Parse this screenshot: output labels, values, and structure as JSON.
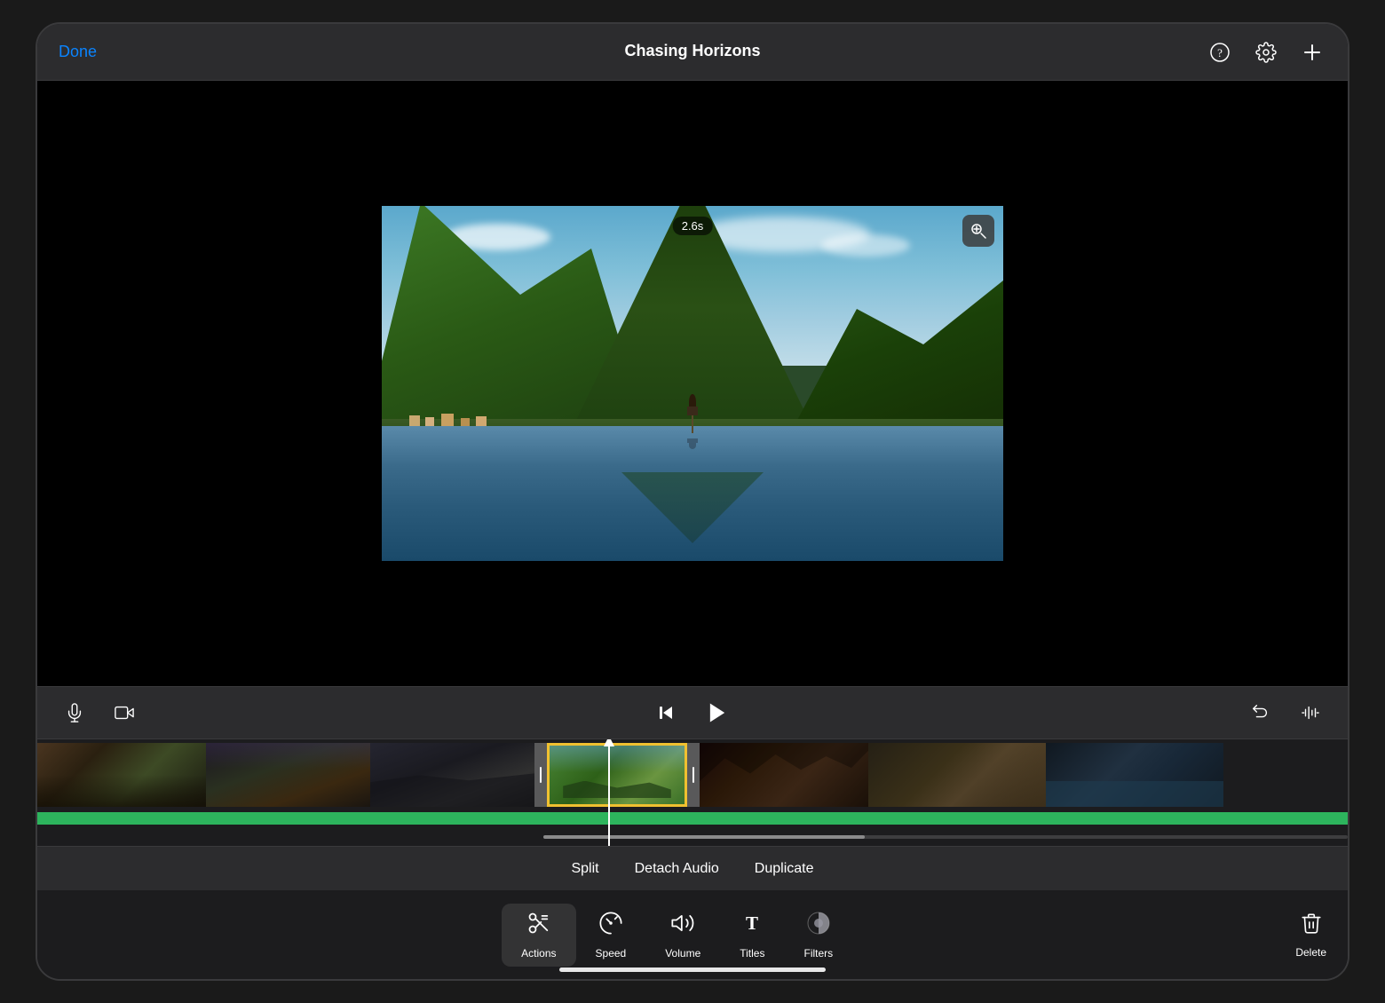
{
  "app": {
    "title": "Chasing Horizons"
  },
  "header": {
    "done_label": "Done",
    "title": "Chasing Horizons",
    "help_icon": "?",
    "settings_icon": "⚙",
    "add_icon": "+"
  },
  "preview": {
    "time_badge": "2.6s",
    "zoom_icon": "zoom"
  },
  "controls": {
    "mic_icon": "mic",
    "camera_icon": "camera",
    "skip_back_icon": "skip-back",
    "play_icon": "play",
    "undo_icon": "undo",
    "audio_wave_icon": "audio-wave"
  },
  "context_menu": {
    "split_label": "Split",
    "detach_audio_label": "Detach Audio",
    "duplicate_label": "Duplicate"
  },
  "toolbar": {
    "tools": [
      {
        "id": "actions",
        "label": "Actions",
        "icon": "scissors"
      },
      {
        "id": "speed",
        "label": "Speed",
        "icon": "gauge"
      },
      {
        "id": "volume",
        "label": "Volume",
        "icon": "speaker"
      },
      {
        "id": "titles",
        "label": "Titles",
        "icon": "T"
      },
      {
        "id": "filters",
        "label": "Filters",
        "icon": "filters"
      }
    ],
    "delete_label": "Delete"
  }
}
